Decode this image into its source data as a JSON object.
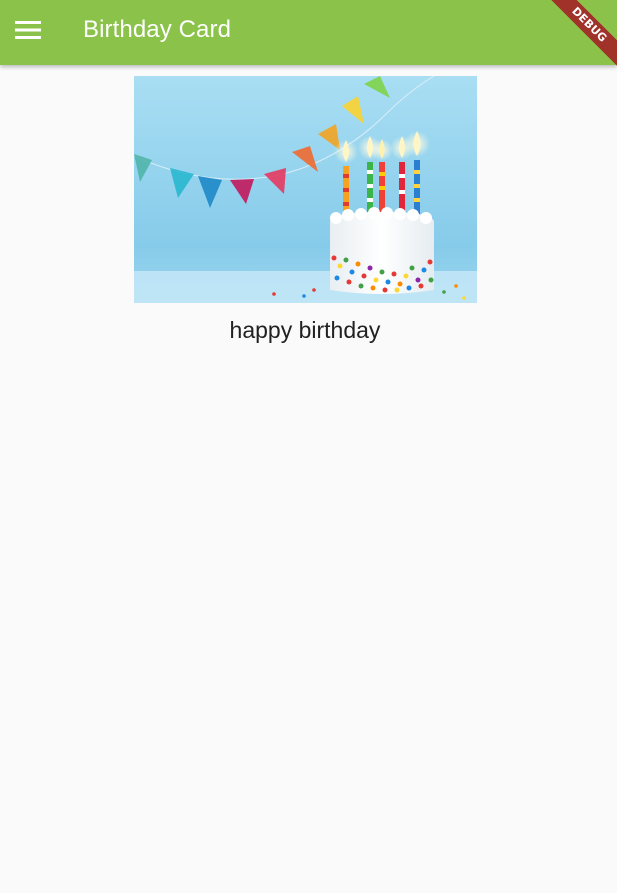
{
  "app_bar": {
    "title": "Birthday Card",
    "background_color": "#8bc34a",
    "menu_icon": "menu-icon"
  },
  "debug_banner": {
    "label": "DEBUG",
    "color": "#a0322a"
  },
  "card": {
    "image": "birthday-cake-with-candles-and-bunting",
    "caption": "happy birthday"
  }
}
